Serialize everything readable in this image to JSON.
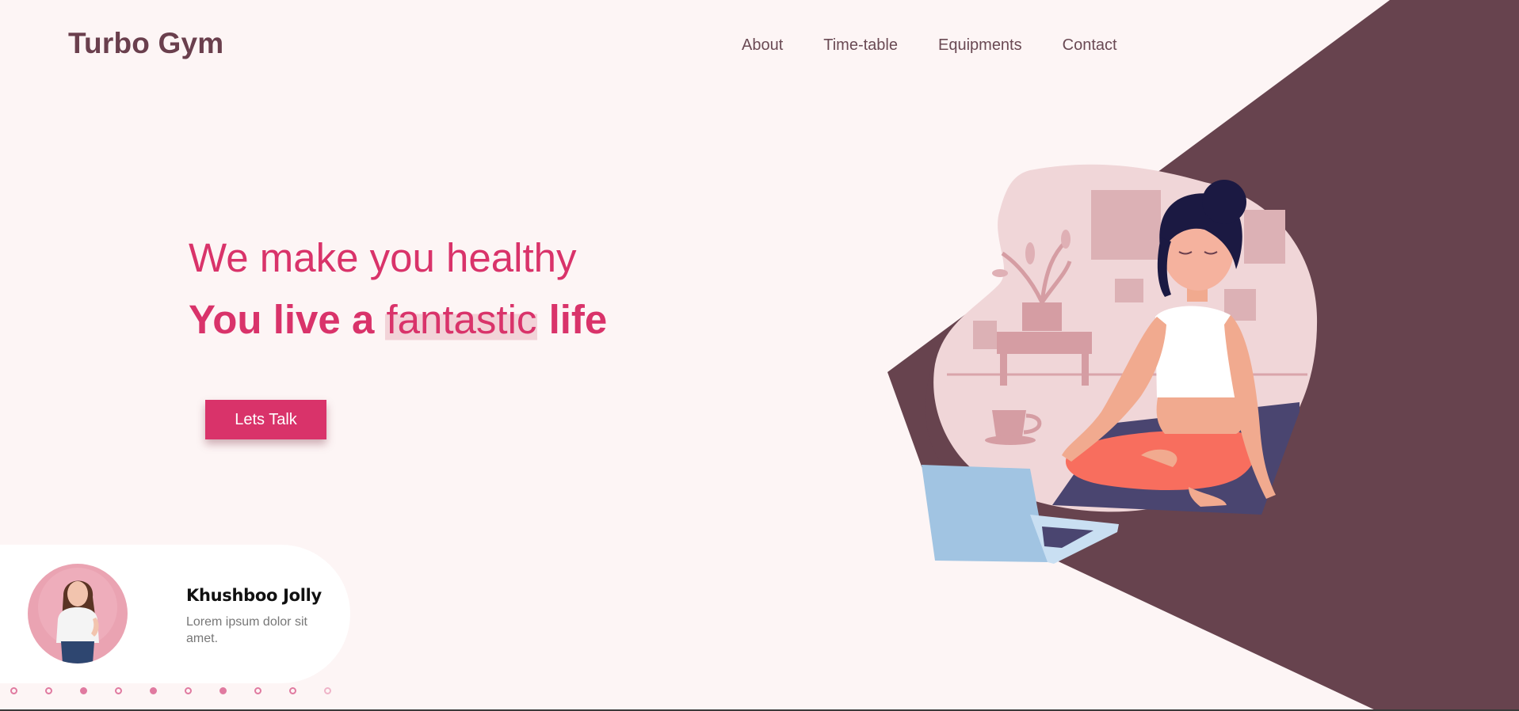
{
  "brand": {
    "name": "Turbo Gym"
  },
  "nav": {
    "items": [
      {
        "label": "About"
      },
      {
        "label": "Time-table"
      },
      {
        "label": "Equipments"
      },
      {
        "label": "Contact"
      }
    ]
  },
  "hero": {
    "line1": "We make you healthy",
    "line2_prefix": "You live a",
    "line2_highlight": "fantastic",
    "line2_suffix": "life",
    "cta_label": "Lets Talk"
  },
  "testimonial": {
    "name": "Khushboo Jolly",
    "text": "Lorem ipsum dolor sit amet."
  },
  "carousel": {
    "dots": [
      "empty",
      "empty",
      "filled",
      "empty",
      "filled",
      "empty",
      "filled",
      "empty",
      "empty",
      "faded"
    ]
  },
  "colors": {
    "background": "#fdf5f5",
    "accent": "#d9336a",
    "dark": "#6a3f4d",
    "illustration_blob": "#f0d6d8"
  },
  "icons": {
    "hero_illustration": "meditating-woman-illustration",
    "avatar": "user-avatar-photo"
  }
}
